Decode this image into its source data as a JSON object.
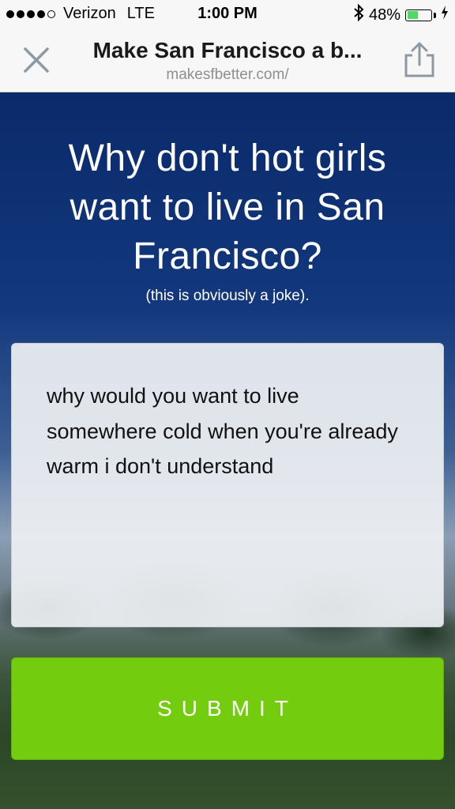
{
  "status_bar": {
    "carrier": "Verizon",
    "network": "LTE",
    "time": "1:00 PM",
    "battery": "48%",
    "battery_level": 0.48
  },
  "nav": {
    "title": "Make San Francisco a b...",
    "url": "makesfbetter.com/",
    "close_icon": "close-icon",
    "share_icon": "share-icon"
  },
  "main": {
    "headline": "Why don't hot girls want to live in San Francisco?",
    "subline": "(this is obviously a joke).",
    "answer_text": "why would you want to live somewhere cold when you're already warm i don't understand",
    "submit_label": "SUBMIT"
  },
  "colors": {
    "submit_bg": "#74cc0e",
    "battery_fill": "#4cd964"
  }
}
